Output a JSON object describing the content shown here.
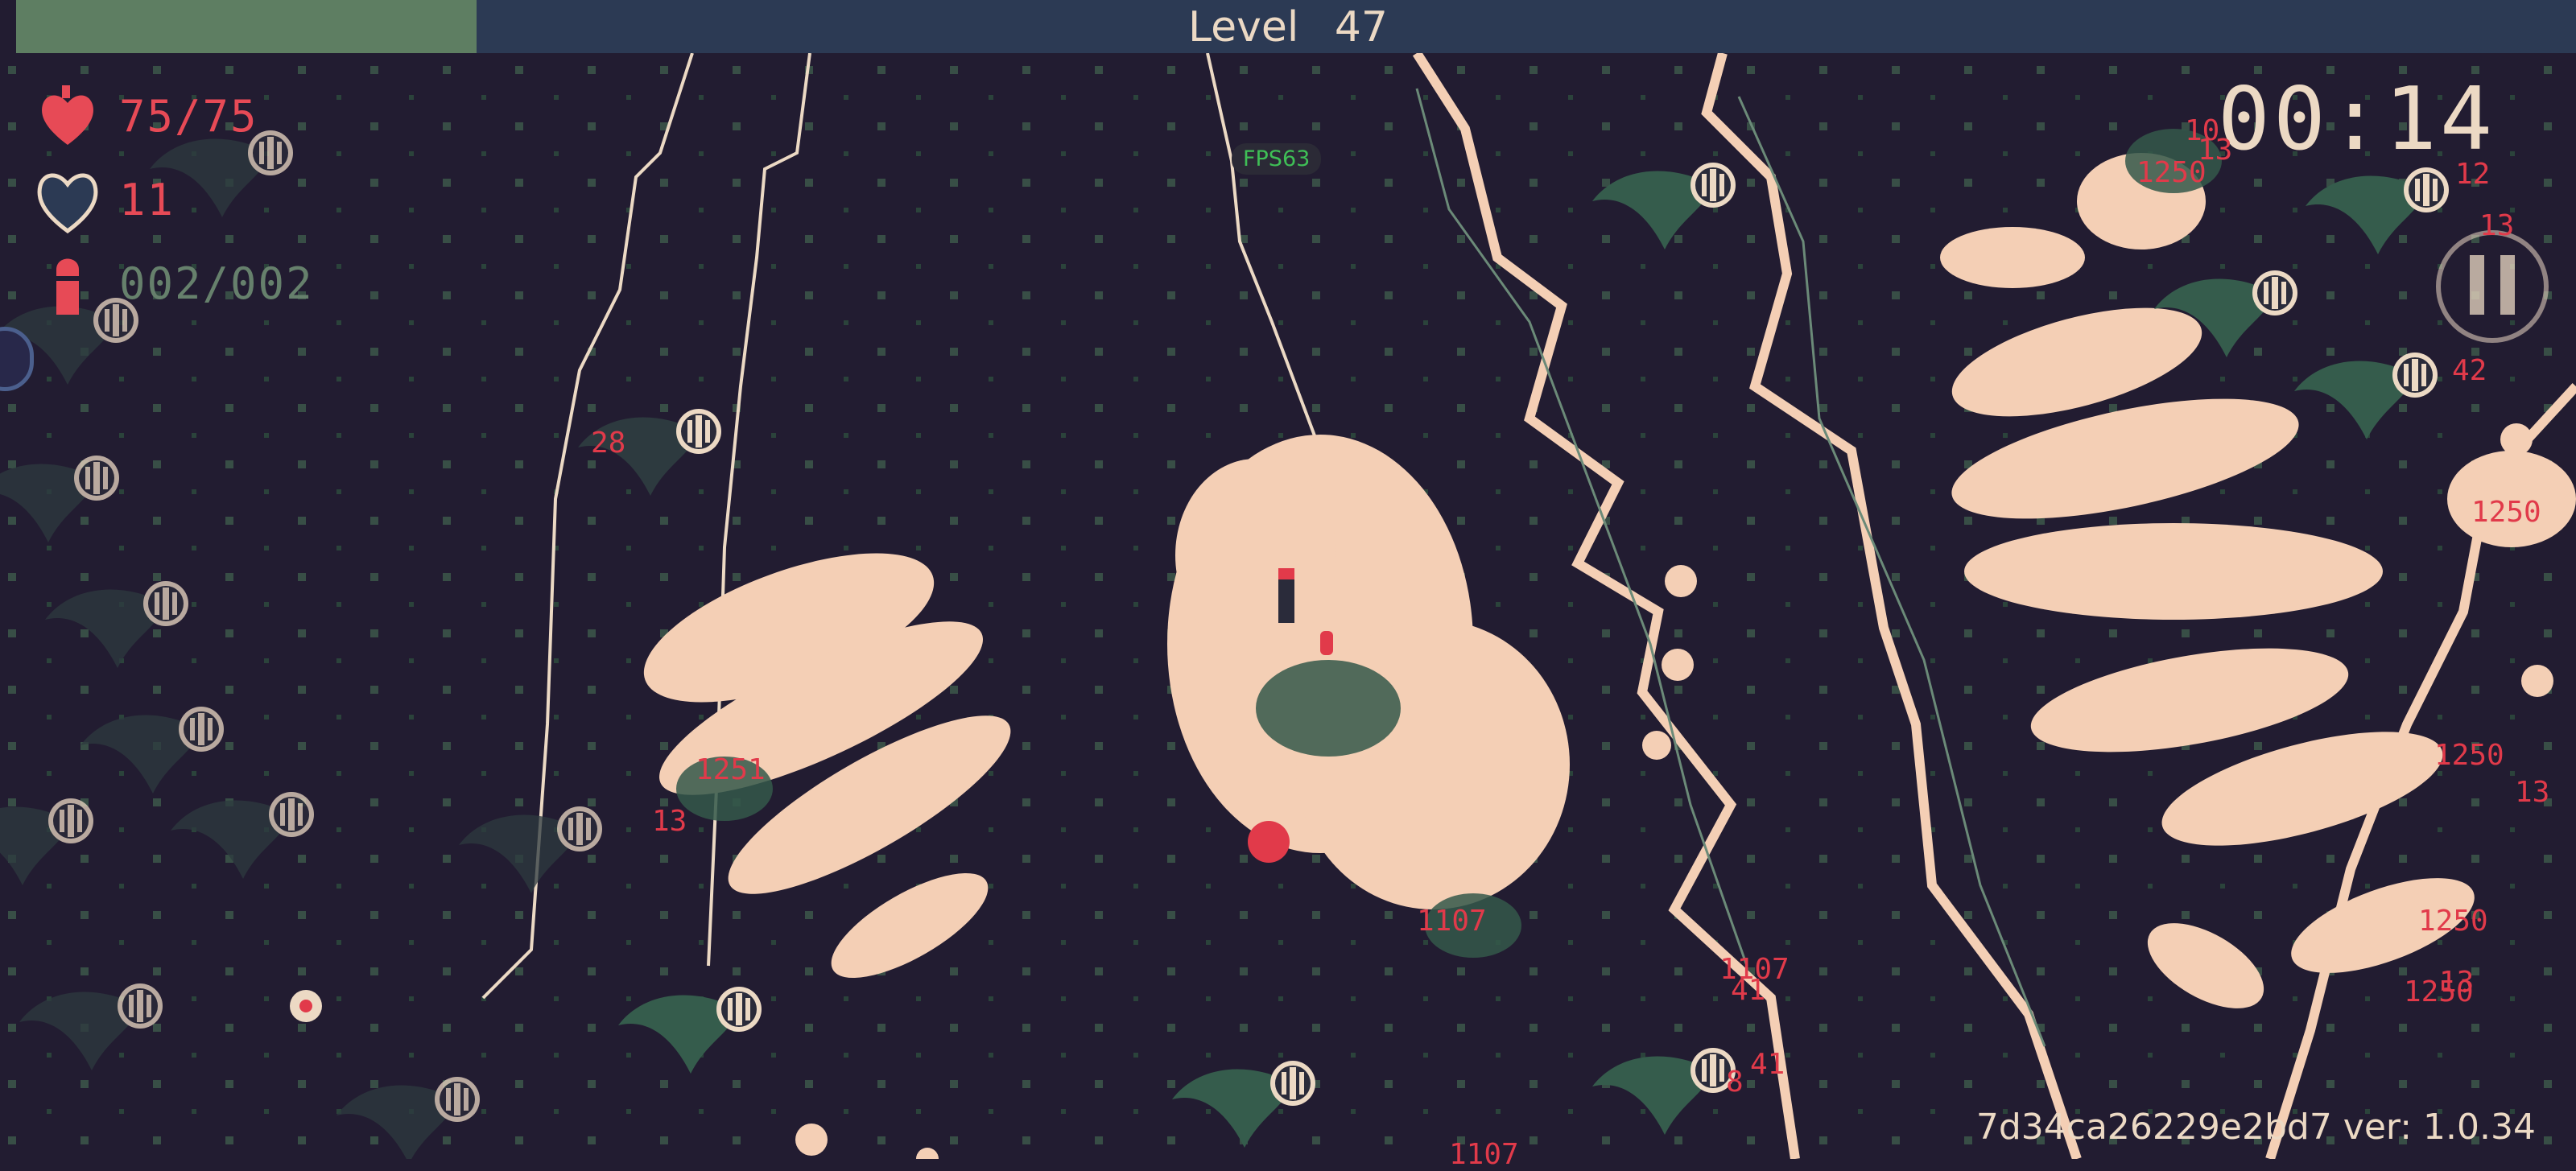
{
  "hud": {
    "level_label": "Level",
    "level_value": "47",
    "xp_progress_fraction": 0.18,
    "health": "75/75",
    "armor": "11",
    "ammo": "002/002",
    "timer": "00:14",
    "fps": "FPS63",
    "build_info": "7d34ca26229e2bd7 ver: 1.0.34"
  },
  "damage_numbers": [
    "10",
    "13",
    "1250",
    "12",
    "13",
    "28",
    "42",
    "1250",
    "1251",
    "13",
    "1107",
    "1107",
    "41",
    "8",
    "41",
    "1250",
    "13",
    "1250",
    "13",
    "1250",
    "1107"
  ],
  "colors": {
    "background": "#221c31",
    "xp_bar": "#2c3a54",
    "xp_fill": "#5e7e62",
    "foliage_cream": "#f4cfb5",
    "foliage_green": "#34584a",
    "damage_red": "#e13a4a",
    "hud_red": "#e74a56",
    "text_cream": "#ecd9c4"
  },
  "icons": [
    "heart-icon",
    "armor-heart-icon",
    "bullet-icon",
    "pause-icon",
    "skull-enemy-icon"
  ]
}
